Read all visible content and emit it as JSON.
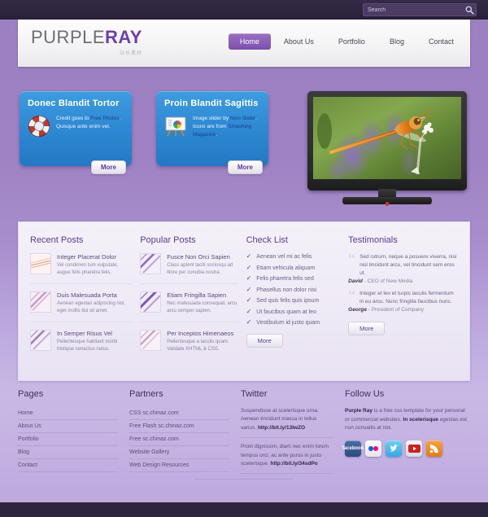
{
  "topbar": {
    "search_placeholder": "Search",
    "search_value": "",
    "search_icon": "search-icon"
  },
  "header": {
    "logo_part1": "PURPLE",
    "logo_part2": "RAY",
    "logo_subtitle": "站长素材",
    "nav": [
      {
        "label": "Home",
        "active": true
      },
      {
        "label": "About Us",
        "active": false
      },
      {
        "label": "Portfolio",
        "active": false
      },
      {
        "label": "Blog",
        "active": false
      },
      {
        "label": "Contact",
        "active": false
      }
    ]
  },
  "promos": [
    {
      "title": "Donec Blandit Tortor",
      "icon": "life-ring-icon",
      "text_before": "Credit goes to ",
      "link1": "Free",
      "link2": "Photos",
      "text_after": ". Quisque ante enim vel.",
      "more_label": "More"
    },
    {
      "title": "Proin Blandit Sagittis",
      "icon": "presentation-chart-icon",
      "text_before": "Image slider by ",
      "link1": "Nivo",
      "link2": "Slider",
      "text_after": ". Icons are from ",
      "link3": "Smashing Magazine",
      "text_end": ".",
      "more_label": "More"
    }
  ],
  "tv": {
    "image_caption": "dragonfly-on-lavender-photo"
  },
  "recent_posts": {
    "heading": "Recent Posts",
    "items": [
      {
        "title": "Integer Placerat Dolor",
        "desc": "Vel condimen tum vulputate, augue felis pharetra felis."
      },
      {
        "title": "Duis Malesuada Porta",
        "desc": "Aenean egestas adipiscing nisl, eget mollis dui sit amet."
      },
      {
        "title": "In Semper Risus Vel",
        "desc": "Pellentesque habitant morbi tristique senectus netus."
      }
    ]
  },
  "popular_posts": {
    "heading": "Popular Posts",
    "items": [
      {
        "title": "Fusce Non Orci Sapien",
        "desc": "Class aptent taciti sociosqu ad litore per conubia nostra."
      },
      {
        "title": "Etiam Fringilla Sapien",
        "desc": "Nec malesuada consequat, arcu arcu semper sapien."
      },
      {
        "title": "Per Inceptos Himenaeos",
        "desc": "Pellentesque a iaculis quam. Validate XHTML & CSS."
      }
    ]
  },
  "check_list": {
    "heading": "Check List",
    "items": [
      "Aenean vel mi ac felis",
      "Etiam vehicula aliquam",
      "Felis pharetra felis sed",
      "Phasellus non dolor nisi",
      "Sed quis felis quis ipsum",
      "Ut faucibus quam at leo",
      "Vestibulum id justo quam"
    ],
    "more_label": "More"
  },
  "testimonials": {
    "heading": "Testimonials",
    "items": [
      {
        "quote": "Sed rutrum, neque a posuere viverra, nisi nisl tincidunt arcu, vel tincidunt sem eros ut.",
        "author": "David",
        "role": " - CEO of New Media"
      },
      {
        "quote": "Integer et leo et turpis iaculis fermentum in eu arcu. Nunc fringilla faucibus nunc.",
        "author": "George",
        "role": " - President of Company"
      }
    ],
    "more_label": "More"
  },
  "footer": {
    "pages": {
      "heading": "Pages",
      "links": [
        "Home",
        "About Us",
        "Portfolio",
        "Blog",
        "Contact"
      ]
    },
    "partners": {
      "heading": "Partners",
      "links": [
        "CSS sc.chinaz.com",
        "Free Flash sc.chinaz.com",
        "Free sc.chinaz.com",
        "Website Gallery",
        "Web Design Resources"
      ]
    },
    "twitter": {
      "heading": "Twitter",
      "tweets": [
        {
          "text": "Suspendisse at scelerisque urna. Aenean tincidunt massa in tellus varius. ",
          "url": "http://bit.ly/13IwZO"
        },
        {
          "text": "Proin dignissim, diam nec enim lorem tempus orci, ac ante purus in justo scelerisque. ",
          "url": "http://bit.ly/34sdPo"
        }
      ]
    },
    "follow": {
      "heading": "Follow Us",
      "brand": "Purple Ray",
      "text_1": " is a free css template for your personal or commercial websites. ",
      "bold_2": "In scelerisque",
      "text_2": " egestas est non convallis at nisi.",
      "social": [
        {
          "name": "facebook-icon",
          "label": "f"
        },
        {
          "name": "flickr-icon",
          "label": "••"
        },
        {
          "name": "twitter-icon",
          "label": "t"
        },
        {
          "name": "youtube-icon",
          "label": "▶"
        },
        {
          "name": "rss-icon",
          "label": "≫"
        }
      ]
    }
  },
  "colors": {
    "accent_purple": "#6c3fa8",
    "promo_blue": "#2f8ad4",
    "dark_bar": "#2d2440",
    "page_bg": "#a98fce"
  }
}
